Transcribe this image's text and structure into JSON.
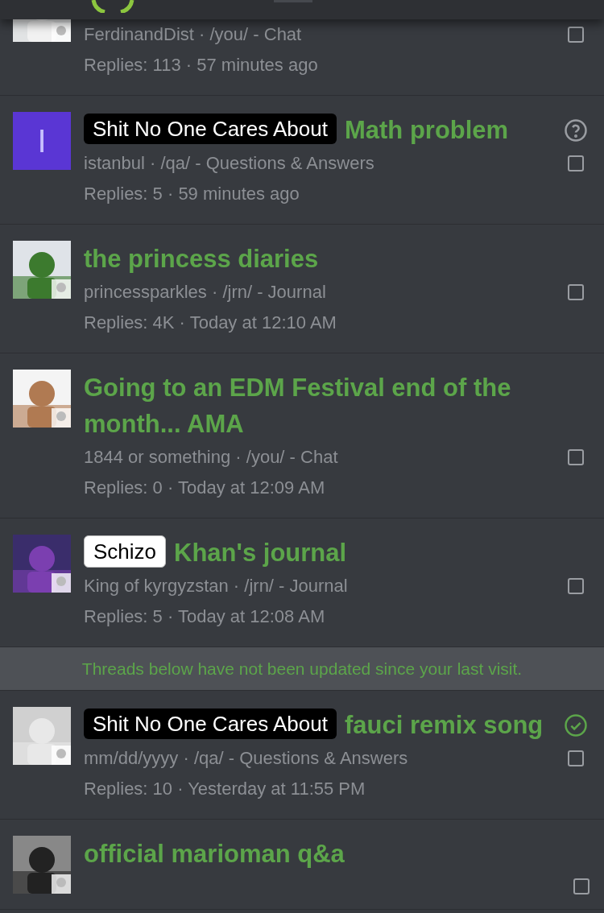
{
  "threads": [
    {
      "author": "FerdinandDist · /you/ - Chat",
      "stats": "Replies: 113 · 57 minutes ago",
      "checked": false
    },
    {
      "avatar": {
        "kind": "letter",
        "letter": "I",
        "color": "#5a36d4"
      },
      "prefix": {
        "label": "Shit No One Cares About",
        "kind": "dark"
      },
      "title": "Math problem",
      "question_mark": true,
      "author": "istanbul · /qa/ - Questions & Answers",
      "stats": "Replies: 5 · 59 minutes ago",
      "checked": false
    },
    {
      "title": "the princess diaries",
      "author": "princessparkles · /jrn/ - Journal",
      "stats": "Replies: 4K · Today at 12:10 AM",
      "checked": false
    },
    {
      "title": "Going to an EDM Festival end of the month... AMA",
      "author": "1844 or something · /you/ - Chat",
      "stats": "Replies: 0 · Today at 12:09 AM",
      "checked": false
    },
    {
      "prefix": {
        "label": "Schizo",
        "kind": "light"
      },
      "title": "Khan's journal",
      "author": "King of kyrgyzstan · /jrn/ - Journal",
      "stats": "Replies: 5 · Today at 12:08 AM",
      "checked": false
    },
    {
      "kind": "notice",
      "text": "Threads below have not been updated since your last visit."
    },
    {
      "prefix": {
        "label": "Shit No One Cares About",
        "kind": "dark"
      },
      "title": "fauci remix song",
      "read_mark": true,
      "author": "mm/dd/yyyy · /qa/ - Questions & Answers",
      "stats": "Replies: 10 · Yesterday at 11:55 PM",
      "checked": false
    },
    {
      "title": "official marioman q&a",
      "checked": false
    }
  ]
}
